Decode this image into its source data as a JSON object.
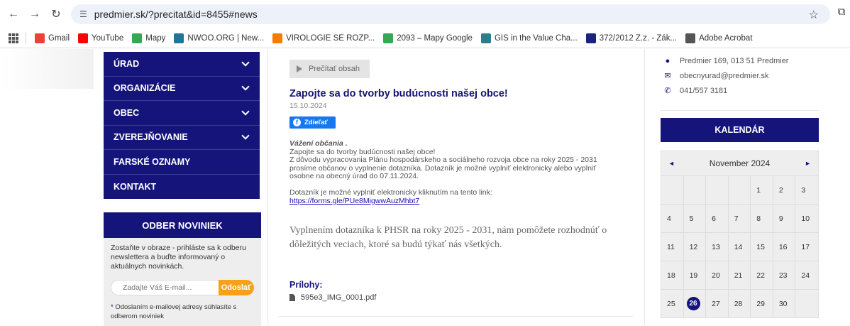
{
  "browser": {
    "url": "predmier.sk/?precitat&id=8455#news",
    "bookmarks": [
      {
        "label": "Gmail",
        "icon": "gmail-icon",
        "color": "#ea4335"
      },
      {
        "label": "YouTube",
        "icon": "youtube-icon",
        "color": "#ff0000"
      },
      {
        "label": "Mapy",
        "icon": "maps-pin-icon",
        "color": "#34a853"
      },
      {
        "label": "NWOO.ORG | New...",
        "icon": "wordpress-icon",
        "color": "#21759b"
      },
      {
        "label": "VIROLOGIE SE ROZP...",
        "icon": "site-icon",
        "color": "#f57c00"
      },
      {
        "label": "2093 – Mapy Google",
        "icon": "maps-pin-icon",
        "color": "#34a853"
      },
      {
        "label": "GIS in the Value Cha...",
        "icon": "site-icon",
        "color": "#2e7d8c"
      },
      {
        "label": "372/2012 Z.z. - Zák...",
        "icon": "paragraph-icon",
        "color": "#1a237e"
      },
      {
        "label": "Adobe Acrobat",
        "icon": "globe-icon",
        "color": "#555555"
      }
    ]
  },
  "menu": {
    "items": [
      {
        "label": "ÚRAD",
        "has_submenu": true
      },
      {
        "label": "ORGANIZÁCIE",
        "has_submenu": true
      },
      {
        "label": "OBEC",
        "has_submenu": true
      },
      {
        "label": "ZVEREJŇOVANIE",
        "has_submenu": true
      },
      {
        "label": "FARSKÉ OZNAMY",
        "has_submenu": false
      },
      {
        "label": "KONTAKT",
        "has_submenu": false
      }
    ]
  },
  "newsletter": {
    "title": "ODBER NOVINIEK",
    "text": "Zostaňte v obraze - prihláste sa k odberu newslettera a buďte informovaný o aktuálnych novinkách.",
    "placeholder": "Zadajte Váš E-mail...",
    "button": "Odoslať",
    "note_star": "*",
    "note": " Odoslaním e-mailovej adresy súhlasíte s odberom noviniek"
  },
  "article": {
    "read_button": "Prečítať obsah",
    "title": "Zapojte sa do tvorby budúcnosti našej obce!",
    "date": "15.10.2024",
    "share": "Zdieľať",
    "greeting": "Vážení občania .",
    "lines": [
      "Zapojte sa do tvorby budúcnosti našej obce!",
      "Z dôvodu vypracovania Plánu hospodárskeho a sociálneho rozvoja obce na roky 2025 - 2031",
      "prosíme občanov o vyplnenie dotazníka. Dotazník je možné vyplniť elektronicky alebo vyplniť",
      "osobne na obecný úrad do 07.11.2024."
    ],
    "link_intro": "Dotazník je možné vyplniť elektronicky kliknutím na tento link:",
    "link": "https://forms.gle/PUe8MigwwAuzMhbt7",
    "serif_text": "Vyplnením dotazníka k PHSR na roky 2025 - 2031, nám pomôžete rozhodnúť o dôležitých veciach, ktoré sa budú týkať nás všetkých.",
    "attachments_title": "Prílohy:",
    "attachment": "595e3_IMG_0001.pdf"
  },
  "contact": {
    "address": "Predmier 169, 013 51 Predmier",
    "email": "obecnyurad@predmier.sk",
    "phone": "041/557 3181"
  },
  "calendar": {
    "title": "KALENDÁR",
    "month": "November 2024",
    "prev": "◄",
    "next": "►",
    "today": "26",
    "weeks": [
      [
        "",
        "",
        "",
        "",
        "1",
        "2",
        "3"
      ],
      [
        "4",
        "5",
        "6",
        "7",
        "8",
        "9",
        "10"
      ],
      [
        "11",
        "12",
        "13",
        "14",
        "15",
        "16",
        "17"
      ],
      [
        "18",
        "19",
        "20",
        "21",
        "22",
        "23",
        "24"
      ],
      [
        "25",
        "26",
        "27",
        "28",
        "29",
        "30",
        ""
      ]
    ]
  }
}
